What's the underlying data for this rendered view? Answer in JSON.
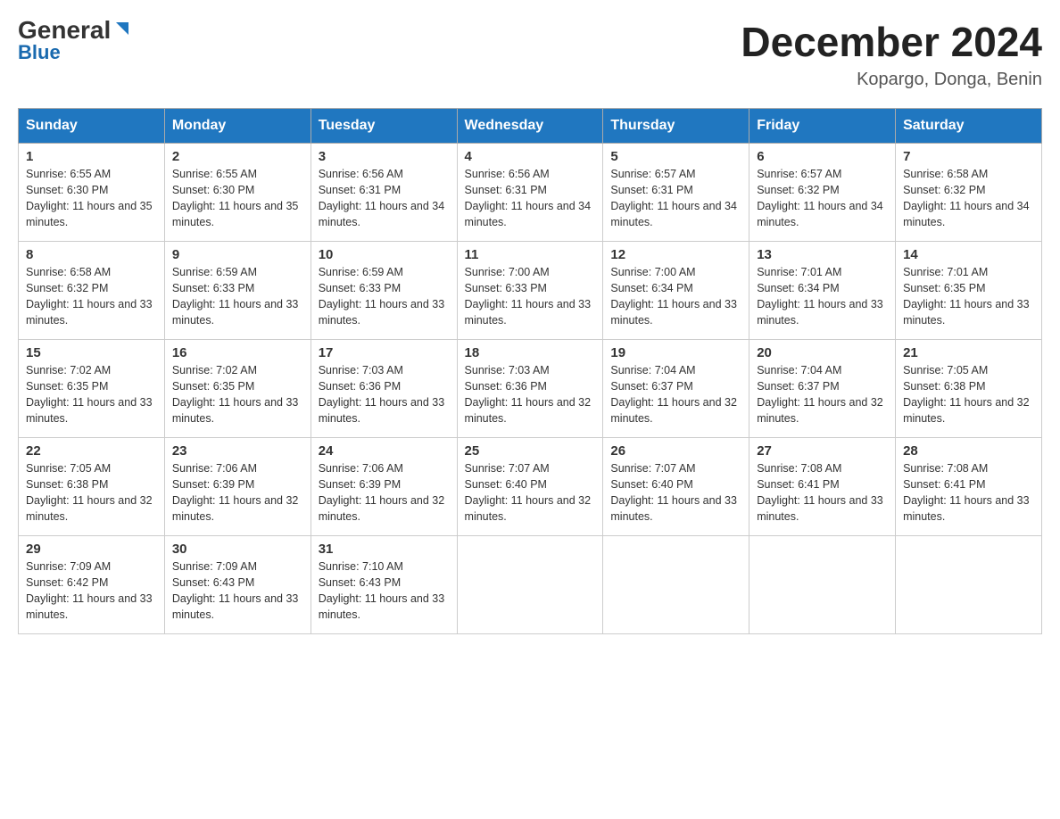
{
  "header": {
    "logo_general": "General",
    "logo_blue": "Blue",
    "month_title": "December 2024",
    "location": "Kopargo, Donga, Benin"
  },
  "days_of_week": [
    "Sunday",
    "Monday",
    "Tuesday",
    "Wednesday",
    "Thursday",
    "Friday",
    "Saturday"
  ],
  "weeks": [
    [
      {
        "day": "1",
        "sunrise": "6:55 AM",
        "sunset": "6:30 PM",
        "daylight": "11 hours and 35 minutes."
      },
      {
        "day": "2",
        "sunrise": "6:55 AM",
        "sunset": "6:30 PM",
        "daylight": "11 hours and 35 minutes."
      },
      {
        "day": "3",
        "sunrise": "6:56 AM",
        "sunset": "6:31 PM",
        "daylight": "11 hours and 34 minutes."
      },
      {
        "day": "4",
        "sunrise": "6:56 AM",
        "sunset": "6:31 PM",
        "daylight": "11 hours and 34 minutes."
      },
      {
        "day": "5",
        "sunrise": "6:57 AM",
        "sunset": "6:31 PM",
        "daylight": "11 hours and 34 minutes."
      },
      {
        "day": "6",
        "sunrise": "6:57 AM",
        "sunset": "6:32 PM",
        "daylight": "11 hours and 34 minutes."
      },
      {
        "day": "7",
        "sunrise": "6:58 AM",
        "sunset": "6:32 PM",
        "daylight": "11 hours and 34 minutes."
      }
    ],
    [
      {
        "day": "8",
        "sunrise": "6:58 AM",
        "sunset": "6:32 PM",
        "daylight": "11 hours and 33 minutes."
      },
      {
        "day": "9",
        "sunrise": "6:59 AM",
        "sunset": "6:33 PM",
        "daylight": "11 hours and 33 minutes."
      },
      {
        "day": "10",
        "sunrise": "6:59 AM",
        "sunset": "6:33 PM",
        "daylight": "11 hours and 33 minutes."
      },
      {
        "day": "11",
        "sunrise": "7:00 AM",
        "sunset": "6:33 PM",
        "daylight": "11 hours and 33 minutes."
      },
      {
        "day": "12",
        "sunrise": "7:00 AM",
        "sunset": "6:34 PM",
        "daylight": "11 hours and 33 minutes."
      },
      {
        "day": "13",
        "sunrise": "7:01 AM",
        "sunset": "6:34 PM",
        "daylight": "11 hours and 33 minutes."
      },
      {
        "day": "14",
        "sunrise": "7:01 AM",
        "sunset": "6:35 PM",
        "daylight": "11 hours and 33 minutes."
      }
    ],
    [
      {
        "day": "15",
        "sunrise": "7:02 AM",
        "sunset": "6:35 PM",
        "daylight": "11 hours and 33 minutes."
      },
      {
        "day": "16",
        "sunrise": "7:02 AM",
        "sunset": "6:35 PM",
        "daylight": "11 hours and 33 minutes."
      },
      {
        "day": "17",
        "sunrise": "7:03 AM",
        "sunset": "6:36 PM",
        "daylight": "11 hours and 33 minutes."
      },
      {
        "day": "18",
        "sunrise": "7:03 AM",
        "sunset": "6:36 PM",
        "daylight": "11 hours and 32 minutes."
      },
      {
        "day": "19",
        "sunrise": "7:04 AM",
        "sunset": "6:37 PM",
        "daylight": "11 hours and 32 minutes."
      },
      {
        "day": "20",
        "sunrise": "7:04 AM",
        "sunset": "6:37 PM",
        "daylight": "11 hours and 32 minutes."
      },
      {
        "day": "21",
        "sunrise": "7:05 AM",
        "sunset": "6:38 PM",
        "daylight": "11 hours and 32 minutes."
      }
    ],
    [
      {
        "day": "22",
        "sunrise": "7:05 AM",
        "sunset": "6:38 PM",
        "daylight": "11 hours and 32 minutes."
      },
      {
        "day": "23",
        "sunrise": "7:06 AM",
        "sunset": "6:39 PM",
        "daylight": "11 hours and 32 minutes."
      },
      {
        "day": "24",
        "sunrise": "7:06 AM",
        "sunset": "6:39 PM",
        "daylight": "11 hours and 32 minutes."
      },
      {
        "day": "25",
        "sunrise": "7:07 AM",
        "sunset": "6:40 PM",
        "daylight": "11 hours and 32 minutes."
      },
      {
        "day": "26",
        "sunrise": "7:07 AM",
        "sunset": "6:40 PM",
        "daylight": "11 hours and 33 minutes."
      },
      {
        "day": "27",
        "sunrise": "7:08 AM",
        "sunset": "6:41 PM",
        "daylight": "11 hours and 33 minutes."
      },
      {
        "day": "28",
        "sunrise": "7:08 AM",
        "sunset": "6:41 PM",
        "daylight": "11 hours and 33 minutes."
      }
    ],
    [
      {
        "day": "29",
        "sunrise": "7:09 AM",
        "sunset": "6:42 PM",
        "daylight": "11 hours and 33 minutes."
      },
      {
        "day": "30",
        "sunrise": "7:09 AM",
        "sunset": "6:43 PM",
        "daylight": "11 hours and 33 minutes."
      },
      {
        "day": "31",
        "sunrise": "7:10 AM",
        "sunset": "6:43 PM",
        "daylight": "11 hours and 33 minutes."
      },
      null,
      null,
      null,
      null
    ]
  ],
  "labels": {
    "sunrise": "Sunrise:",
    "sunset": "Sunset:",
    "daylight": "Daylight:"
  }
}
